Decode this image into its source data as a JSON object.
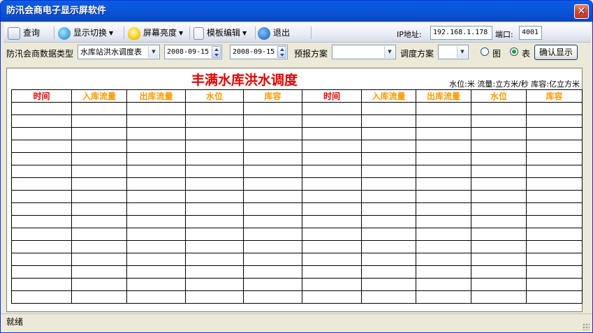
{
  "window": {
    "title": "防汛会商电子显示屏软件",
    "close_glyph": "✕"
  },
  "toolbar": {
    "items": [
      {
        "label": "查询",
        "icon": "magnifier-icon"
      },
      {
        "label": "显示切换",
        "icon": "monitor-switch-icon"
      },
      {
        "label": "屏幕亮度",
        "icon": "lightbulb-icon"
      },
      {
        "label": "模板编辑",
        "icon": "document-icon"
      },
      {
        "label": "退出",
        "icon": "exit-icon"
      }
    ],
    "ip_label": "IP地址:",
    "ip_value": "192.168.1.178",
    "port_label": "端口:",
    "port_value": "4001"
  },
  "filters": {
    "data_type_label": "防汛会商数据类型",
    "data_type_value": "水库站洪水调度表",
    "start_date": "2008-09-15",
    "end_date": "2008-09-15",
    "forecast_label": "预报方案",
    "forecast_value": "",
    "dispatch_label": "调度方案",
    "dispatch_value": "",
    "radio_chart_label": "图",
    "radio_table_label": "表",
    "selected_view": "表",
    "confirm_label": "确认显示"
  },
  "board": {
    "title": "丰满水库洪水调度",
    "units": "水位:米  流量:立方米/秒  库容:亿立方米",
    "columns": [
      "时间",
      "入库流量",
      "出库流量",
      "水位",
      "库容",
      "时间",
      "入库流量",
      "出库流量",
      "水位",
      "库容"
    ],
    "empty_rows": 16
  },
  "status": {
    "text": "就绪"
  },
  "colors": {
    "title_red": "#e00000",
    "header_orange": "#ff9900",
    "titlebar_blue": "#0a54d8"
  }
}
